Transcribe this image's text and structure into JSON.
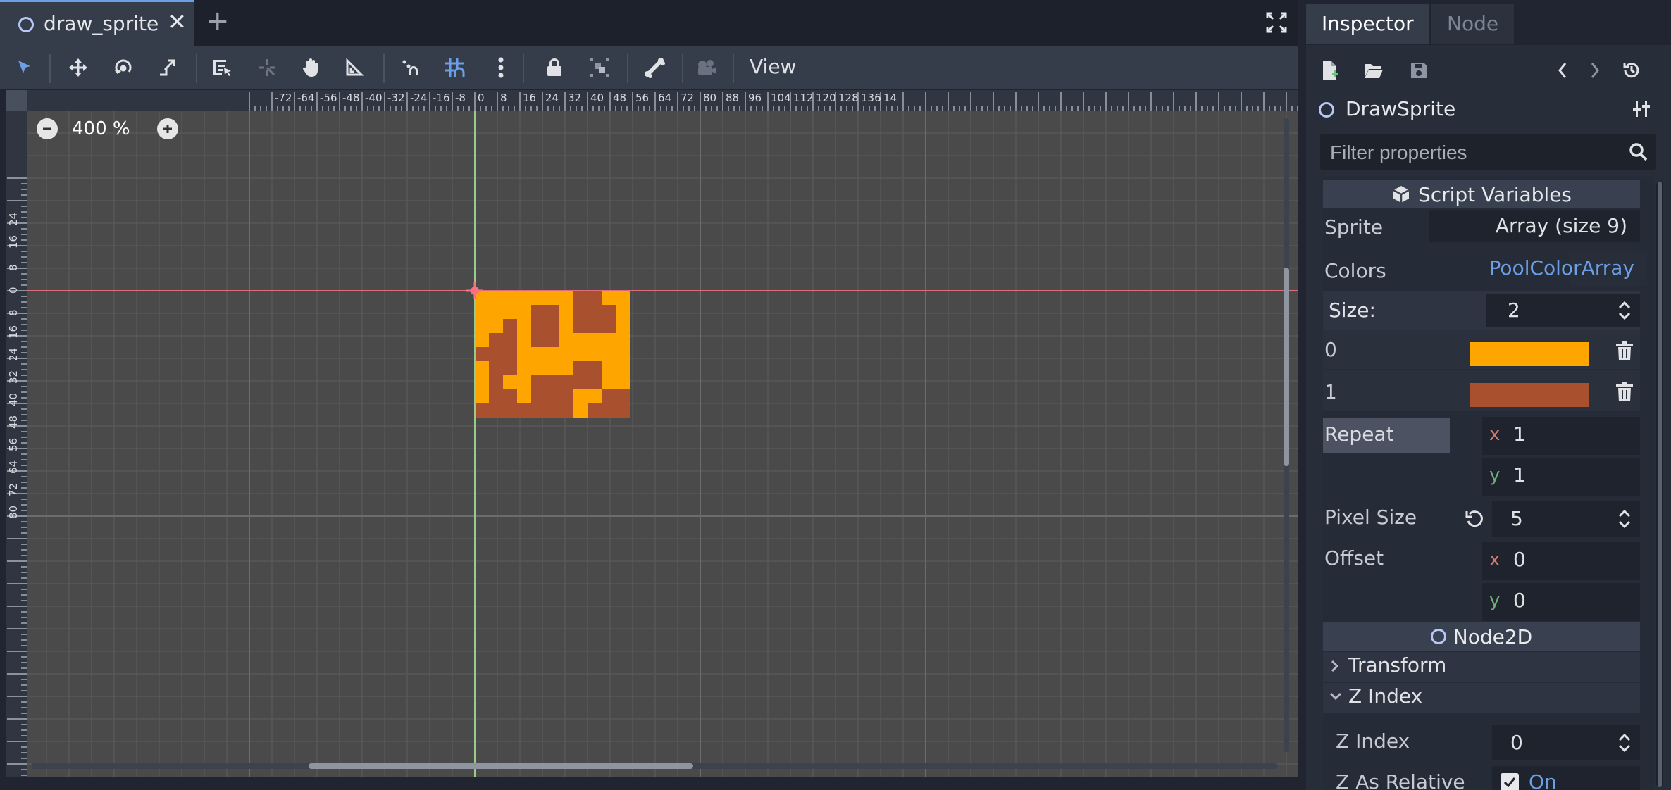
{
  "tab": {
    "name": "draw_sprite",
    "close_icon": "close-icon",
    "add_icon": "plus-icon"
  },
  "toolbar": {
    "view_label": "View",
    "tools": [
      "select-tool-icon",
      "move-tool-icon",
      "rotate-tool-icon",
      "scale-tool-icon",
      "list-select-icon",
      "pivot-tool-icon",
      "pan-tool-icon",
      "ruler-tool-icon",
      "smart-snap-icon",
      "grid-snap-icon",
      "more-vert-icon",
      "lock-icon",
      "group-icon",
      "bone-icon",
      "camera-icon"
    ],
    "active_color": "#6c9fe6"
  },
  "viewport": {
    "zoom": "400 %",
    "ruler_x_ticks": [
      "-72",
      "-64",
      "-56",
      "-48",
      "-40",
      "-32",
      "-24",
      "-16",
      "-8",
      "0",
      "8",
      "16",
      "24",
      "32",
      "40",
      "48",
      "56",
      "64",
      "72",
      "80",
      "88",
      "96",
      "104",
      "112",
      "120",
      "128",
      "136",
      "14"
    ],
    "ruler_y_ticks": [
      "24",
      "16",
      "8",
      "0",
      "8",
      "16",
      "24",
      "32",
      "40",
      "48",
      "56",
      "64",
      "72",
      "80"
    ],
    "sprite_colors": {
      "orange": "#ffa500",
      "brown": "#a9502f"
    }
  },
  "inspector": {
    "tabs": [
      {
        "label": "Inspector",
        "active": true
      },
      {
        "label": "Node",
        "active": false
      }
    ],
    "object_name": "DrawSprite",
    "filter_placeholder": "Filter properties",
    "sections": {
      "script_variables": "Script Variables",
      "node2d": "Node2D"
    },
    "sprite": {
      "label": "Sprite",
      "value": "Array (size 9)"
    },
    "colors": {
      "label": "Colors",
      "value": "PoolColorArray",
      "size_label": "Size:",
      "size_value": "2",
      "items": [
        {
          "index": "0",
          "color": "#ffa500"
        },
        {
          "index": "1",
          "color": "#a9502f"
        }
      ]
    },
    "repeat": {
      "label": "Repeat",
      "x_label": "x",
      "x": "1",
      "y_label": "y",
      "y": "1"
    },
    "pixel_size": {
      "label": "Pixel Size",
      "value": "5"
    },
    "offset": {
      "label": "Offset",
      "x_label": "x",
      "x": "0",
      "y_label": "y",
      "y": "0"
    },
    "transform": {
      "label": "Transform"
    },
    "z_index_group": {
      "label": "Z Index"
    },
    "z_index": {
      "label": "Z Index",
      "value": "0"
    },
    "z_as_relative": {
      "label": "Z As Relative",
      "value": "On"
    }
  }
}
